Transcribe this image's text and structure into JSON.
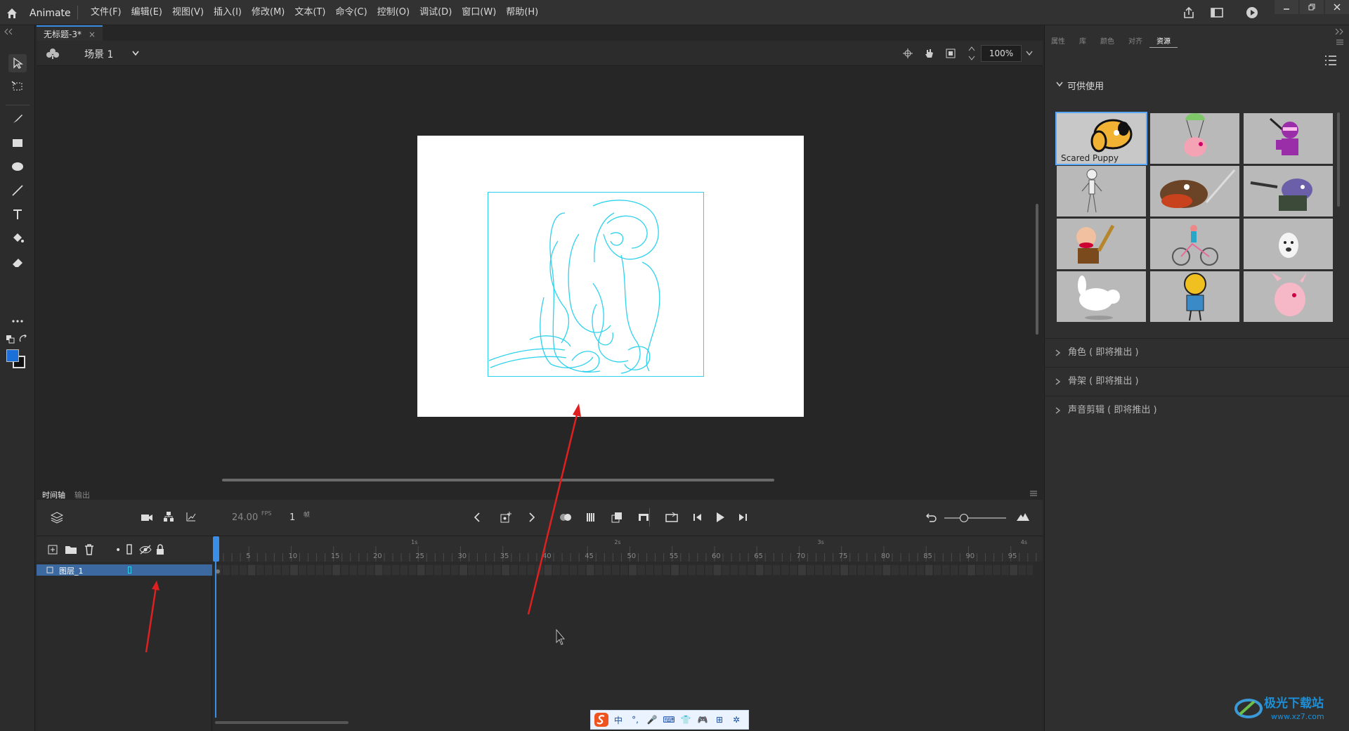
{
  "app": {
    "name": "Animate"
  },
  "menu": [
    "文件(F)",
    "编辑(E)",
    "视图(V)",
    "插入(I)",
    "修改(M)",
    "文本(T)",
    "命令(C)",
    "控制(O)",
    "调试(D)",
    "窗口(W)",
    "帮助(H)"
  ],
  "document_tab": {
    "title": "无标题-3*",
    "close": "×"
  },
  "scene": {
    "label": "场景 1",
    "zoom": "100%"
  },
  "timeline_tabs": {
    "timeline": "时间轴",
    "output": "输出"
  },
  "timeline": {
    "fps": "24.00",
    "fps_unit": "FPS",
    "frame": "1",
    "frame_unit": "帧",
    "seconds": [
      "1s",
      "2s",
      "3s",
      "4s"
    ],
    "frame_ticks": [
      "5",
      "10",
      "15",
      "20",
      "25",
      "30",
      "35",
      "40",
      "45",
      "50",
      "55",
      "60",
      "65",
      "70",
      "75",
      "80",
      "85",
      "90",
      "95"
    ]
  },
  "layer": {
    "name": "图层_1"
  },
  "right_panel": {
    "tabs": [
      "属性",
      "库",
      "颜色",
      "对齐",
      "资源"
    ],
    "active_tab": "资源",
    "available_title": "可供使用",
    "selected_caption": "Scared Puppy",
    "sections": [
      "角色 ( 即将推出 )",
      "骨架 ( 即将推出 )",
      "声音剪辑 ( 即将推出 )"
    ]
  },
  "ime_toolbar": {
    "items": [
      "中",
      "°,",
      "🎤",
      "⌨",
      "👕",
      "🎮",
      "⊞",
      "✲"
    ]
  },
  "watermark": {
    "text": "极光下载站",
    "url": "www.xz7.com"
  },
  "colors": {
    "accent": "#3b8ee6",
    "stroke": "#2ed2ee",
    "arrow": "#e02020",
    "fill_swatch": "#1a6fd8"
  }
}
